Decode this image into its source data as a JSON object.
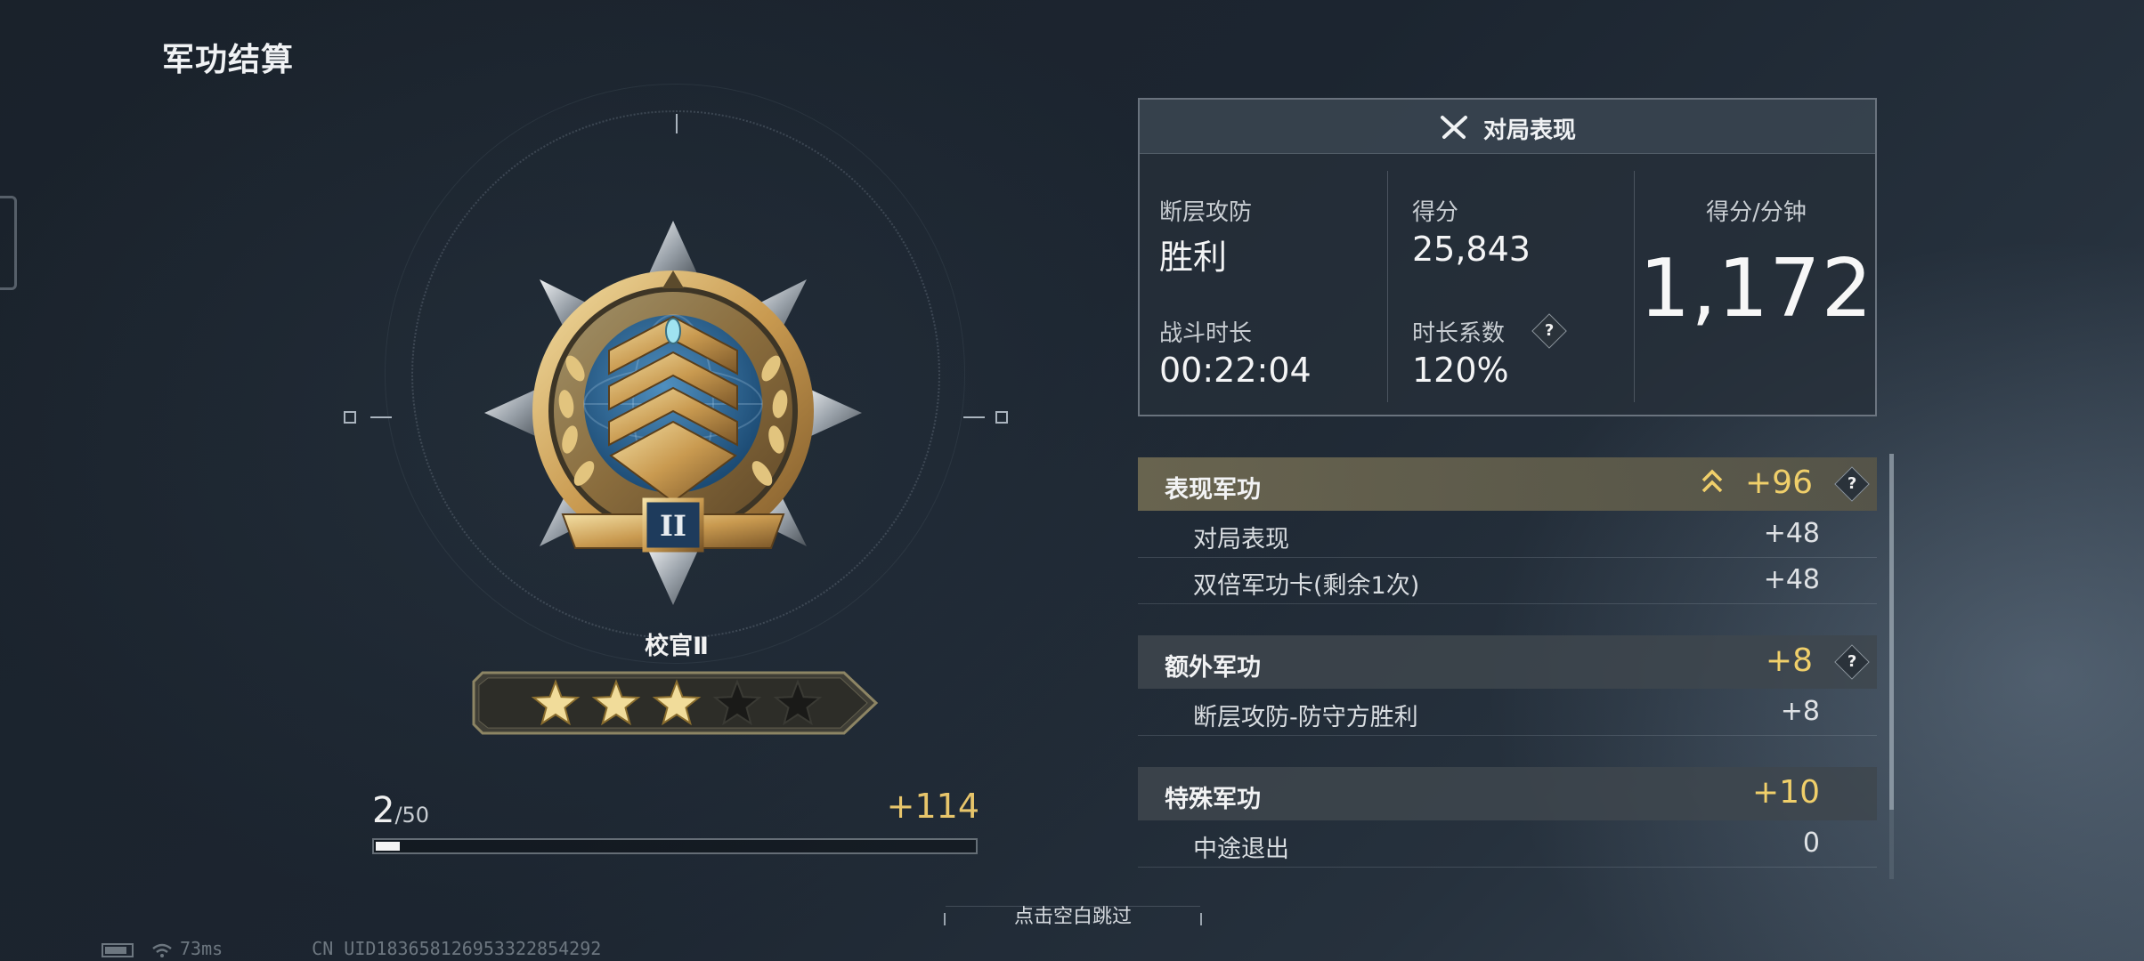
{
  "header": {
    "title": "军功结算"
  },
  "rank": {
    "name": "校官Ⅱ",
    "medal_numeral": "II",
    "stars_filled": 3,
    "stars_total": 5,
    "medal_icon": "rank-medal-icon"
  },
  "progress": {
    "current": "2",
    "max": "/50",
    "gain": "+114",
    "fraction": 0.04
  },
  "performance": {
    "title": "对局表现",
    "icon": "crossed-swords-icon",
    "mode_label": "断层攻防",
    "mode_value": "胜利",
    "duration_label": "战斗时长",
    "duration_value": "00:22:04",
    "score_label": "得分",
    "score_value": "25,843",
    "coef_label": "时长系数",
    "coef_value": "120%",
    "help_glyph": "?",
    "spm_label": "得分/分钟",
    "spm_value": "1,172"
  },
  "merits": [
    {
      "label": "表现军功",
      "value": "+96",
      "has_help": true,
      "highlight": true,
      "items": [
        {
          "label": "对局表现",
          "value": "+48"
        },
        {
          "label": "双倍军功卡(剩余1次)",
          "value": "+48"
        }
      ]
    },
    {
      "label": "额外军功",
      "value": "+8",
      "has_help": true,
      "items": [
        {
          "label": "断层攻防-防守方胜利",
          "value": "+8"
        }
      ]
    },
    {
      "label": "特殊军功",
      "value": "+10",
      "has_help": false,
      "items": [
        {
          "label": "中途退出",
          "value": "0"
        }
      ]
    }
  ],
  "footer": {
    "skip_hint": "点击空白跳过",
    "ping": "73ms",
    "uid": "CN UID1836581269533228542​92"
  },
  "colors": {
    "gold": "#f0cf6a",
    "accent_bg": "#706a52"
  }
}
